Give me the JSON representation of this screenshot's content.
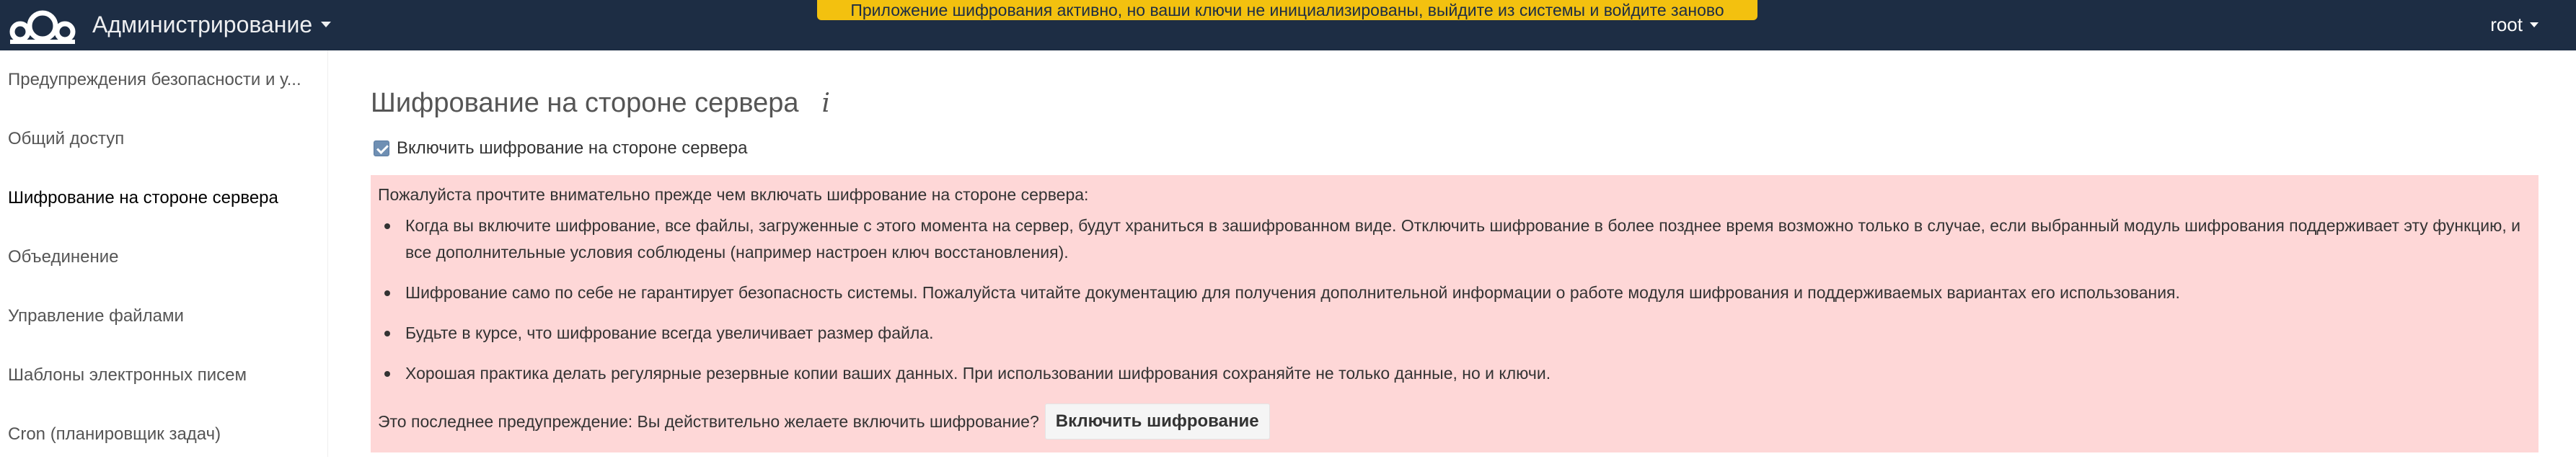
{
  "header": {
    "app_title": "Администрирование",
    "notification": "Приложение шифрования активно, но ваши ключи не инициализированы, выйдите из системы и войдите заново",
    "user": "root",
    "logo_icon": "cloud-logo-icon",
    "colors": {
      "background": "#1d2d44",
      "notification": "#f3c10f"
    }
  },
  "sidebar": {
    "items": [
      {
        "label": "Предупреждения безопасности и у..."
      },
      {
        "label": "Общий доступ"
      },
      {
        "label": "Шифрование на стороне сервера",
        "active": true
      },
      {
        "label": "Объединение"
      },
      {
        "label": "Управление файлами"
      },
      {
        "label": "Шаблоны электронных писем"
      },
      {
        "label": "Cron (планировщик задач)"
      }
    ]
  },
  "main": {
    "title": "Шифрование на стороне сервера",
    "info_icon": "info-icon",
    "checkbox": {
      "label": "Включить шифрование на стороне сервера",
      "checked": true
    },
    "warning": {
      "intro": "Пожалуйста прочтите внимательно прежде чем включать шифрование на стороне сервера:",
      "items": [
        "Когда вы включите шифрование, все файлы, загруженные с этого момента на сервер, будут храниться в зашифрованном виде. Отключить шифрование в более позднее время возможно только в случае, если выбранный модуль шифрования поддерживает эту функцию, и все дополнительные условия соблюдены (например настроен ключ восстановления).",
        "Шифрование само по себе не гарантирует безопасность системы. Пожалуйста читайте документацию для получения дополнительной информации о работе модуля шифрования и поддерживаемых вариантах его использования.",
        "Будьте в курсе, что шифрование всегда увеличивает размер файла.",
        "Хорошая практика делать регулярные резервные копии ваших данных. При использовании шифрования сохраняйте не только данные, но и ключи."
      ],
      "final_question": "Это последнее предупреждение: Вы действительно желаете включить шифрование?",
      "button_label": "Включить шифрование",
      "colors": {
        "background": "#fed7d7"
      }
    }
  }
}
